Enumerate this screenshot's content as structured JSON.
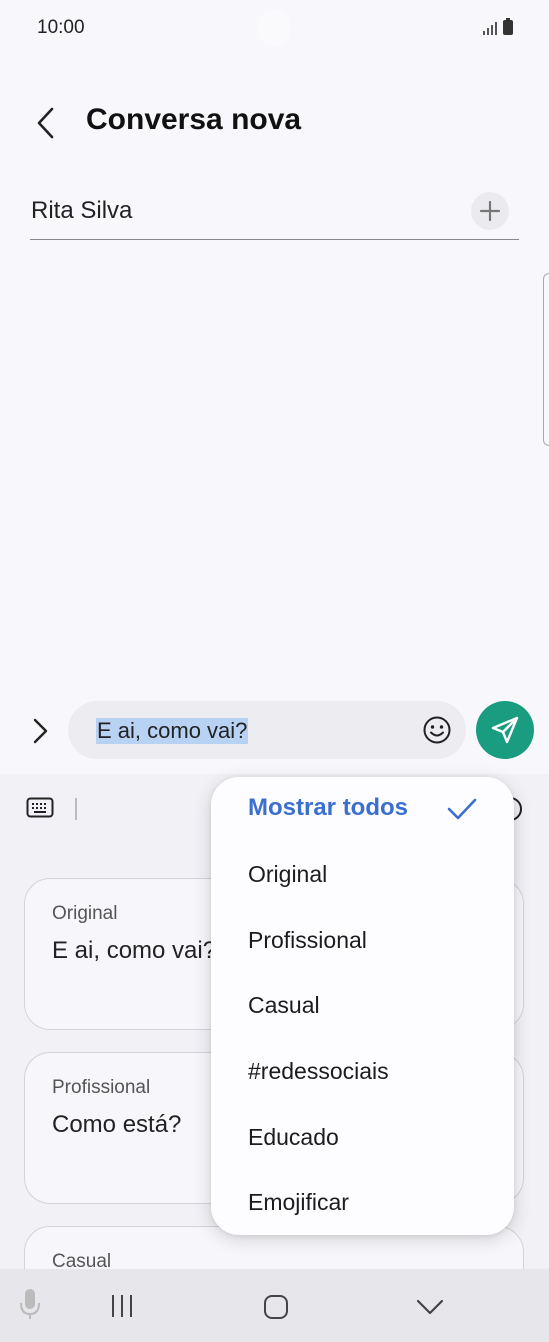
{
  "status_bar": {
    "time": "10:00"
  },
  "header": {
    "title": "Conversa nova"
  },
  "recipient": {
    "name": "Rita Silva"
  },
  "compose": {
    "message": "E ai, como vai?"
  },
  "suggestion_cards": [
    {
      "label": "Original",
      "text": "E ai, como vai?"
    },
    {
      "label": "Profissional",
      "text": "Como está?"
    },
    {
      "label": "Casual",
      "text": ""
    }
  ],
  "dropdown": {
    "selected": "Mostrar todos",
    "items": [
      "Original",
      "Profissional",
      "Casual",
      "#redessociais",
      "Educado",
      "Emojificar"
    ]
  },
  "colors": {
    "accent": "#3a6fd0",
    "send_button": "#1a9c81",
    "selection_highlight": "#b7d2f3"
  },
  "icons": {
    "back": "chevron-left-icon",
    "add": "plus-icon",
    "expand": "chevron-right-icon",
    "emoji": "smiley-icon",
    "send": "paper-plane-icon",
    "keyboard": "keyboard-icon",
    "check": "check-icon",
    "mic": "microphone-icon",
    "recents": "recent-apps-icon",
    "home": "home-icon",
    "nav_back": "chevron-down-icon"
  }
}
